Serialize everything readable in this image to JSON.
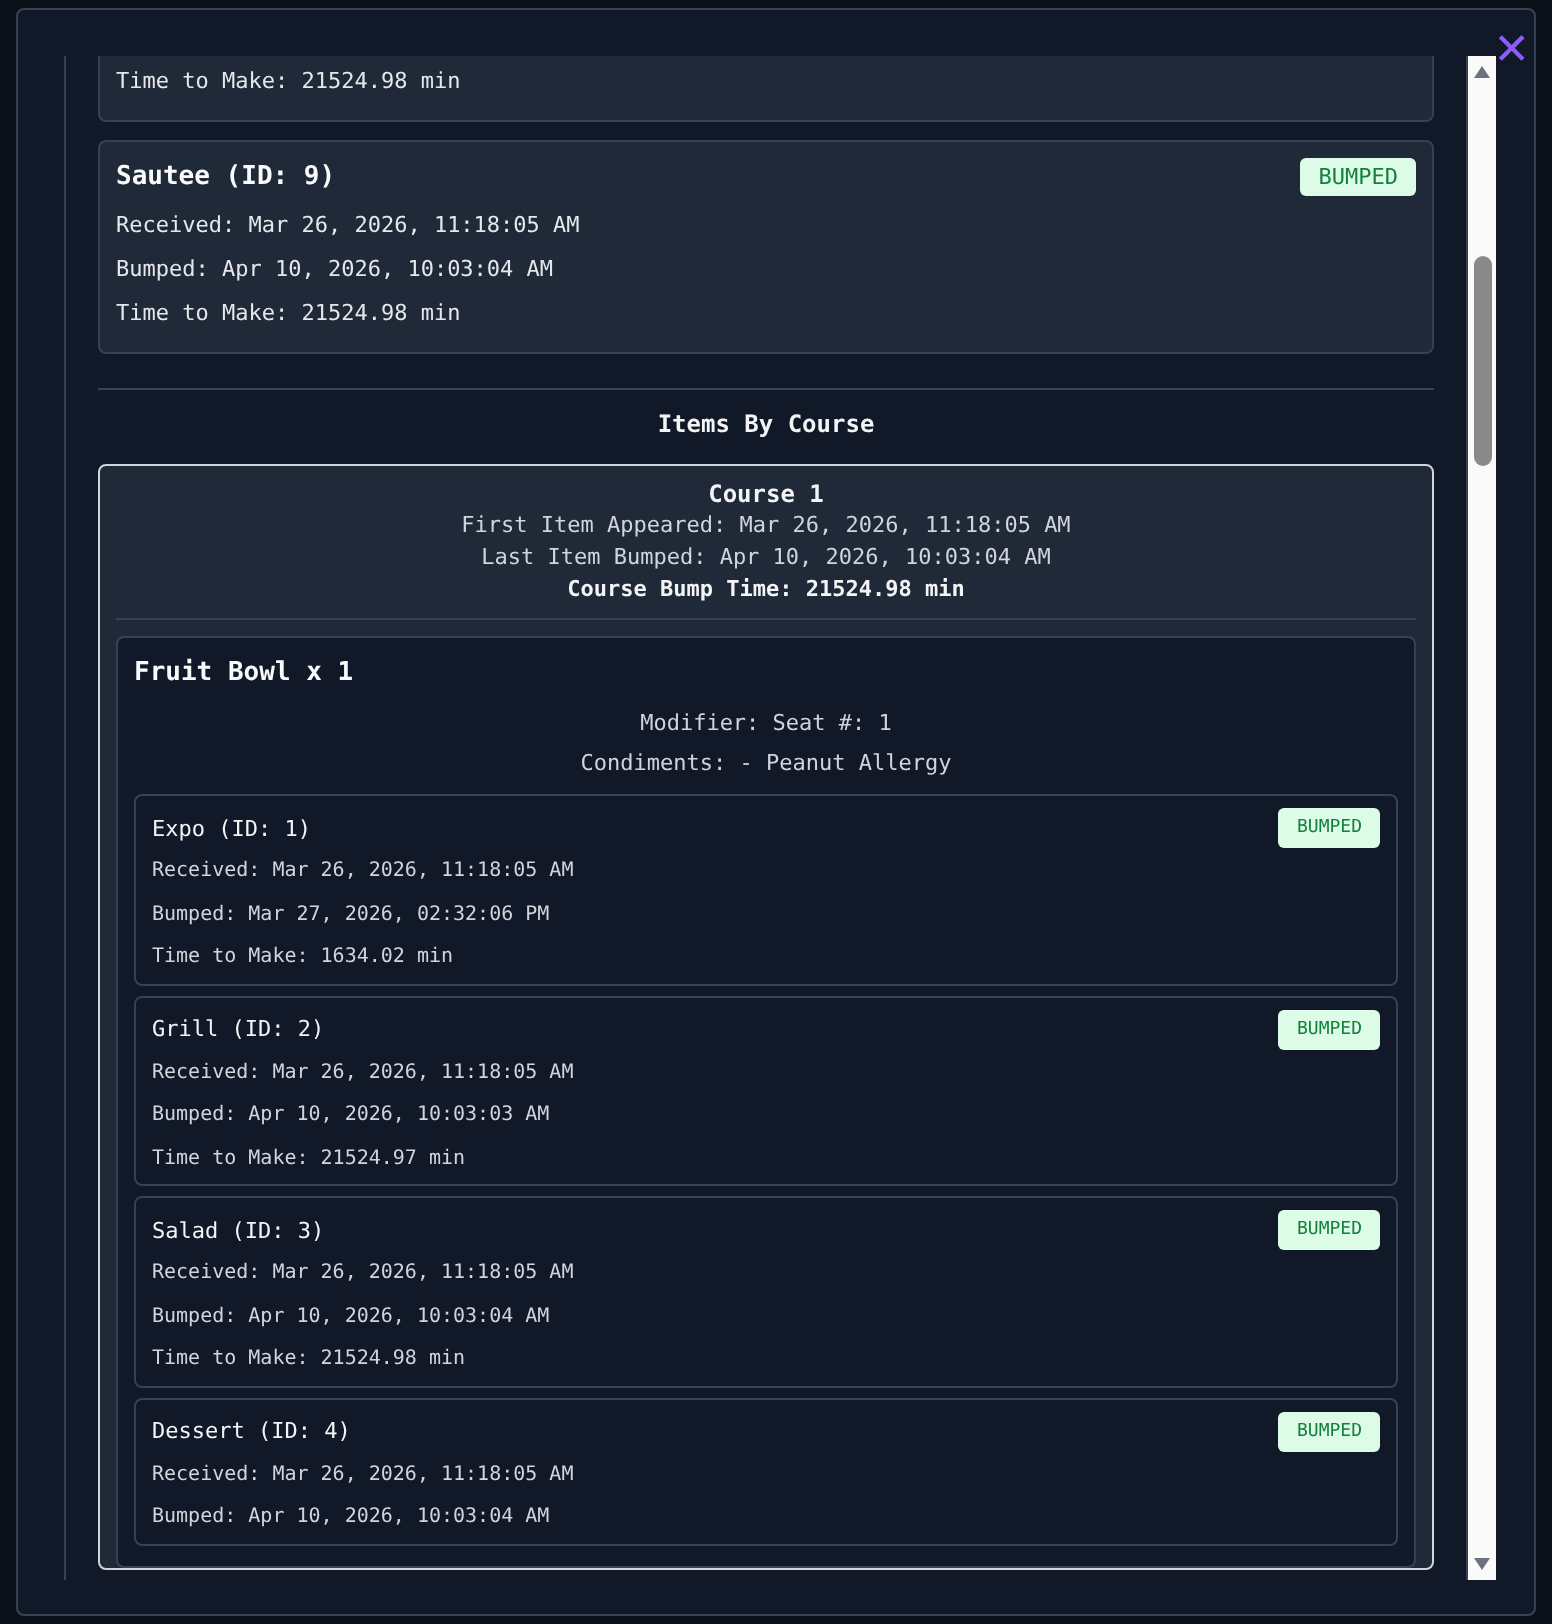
{
  "close_button": {
    "label": "✕"
  },
  "orders": [
    {
      "lines": [
        "Time to Make: 21524.98 min"
      ]
    },
    {
      "title": "Sautee (ID: 9)",
      "badge": "BUMPED",
      "lines": [
        "Received: Mar 26, 2026, 11:18:05 AM",
        "Bumped: Apr 10, 2026, 10:03:04 AM",
        "Time to Make: 21524.98 min"
      ]
    }
  ],
  "section_title": "Items By Course",
  "courses": [
    {
      "title": "Course 1",
      "first_appeared": "First Item Appeared: Mar 26, 2026, 11:18:05 AM",
      "last_bumped": "Last Item Bumped: Apr 10, 2026, 10:03:04 AM",
      "bump_time": "Course Bump Time: 21524.98 min",
      "items": [
        {
          "name": "Fruit Bowl x 1",
          "modifier": "Modifier: Seat #: 1",
          "condiments": "Condiments: - Peanut Allergy",
          "stations": [
            {
              "title": "Expo (ID: 1)",
              "badge": "BUMPED",
              "lines": [
                "Received: Mar 26, 2026, 11:18:05 AM",
                "Bumped: Mar 27, 2026, 02:32:06 PM",
                "Time to Make: 1634.02 min"
              ]
            },
            {
              "title": "Grill (ID: 2)",
              "badge": "BUMPED",
              "lines": [
                "Received: Mar 26, 2026, 11:18:05 AM",
                "Bumped: Apr 10, 2026, 10:03:03 AM",
                "Time to Make: 21524.97 min"
              ]
            },
            {
              "title": "Salad (ID: 3)",
              "badge": "BUMPED",
              "lines": [
                "Received: Mar 26, 2026, 11:18:05 AM",
                "Bumped: Apr 10, 2026, 10:03:04 AM",
                "Time to Make: 21524.98 min"
              ]
            },
            {
              "title": "Dessert (ID: 4)",
              "badge": "BUMPED",
              "lines": [
                "Received: Mar 26, 2026, 11:18:05 AM",
                "Bumped: Apr 10, 2026, 10:03:04 AM"
              ]
            }
          ]
        }
      ]
    }
  ]
}
